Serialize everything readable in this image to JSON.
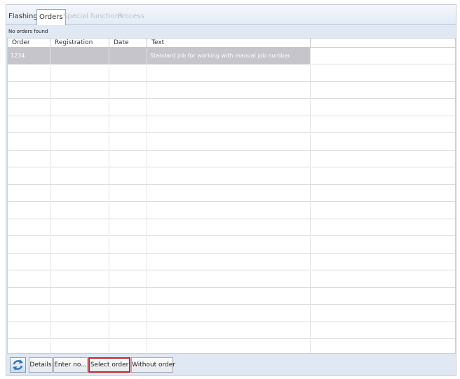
{
  "tabs": [
    {
      "label": "Flashing",
      "state": "normal"
    },
    {
      "label": "Orders",
      "state": "active"
    },
    {
      "label": "Special functions",
      "state": "disabled"
    },
    {
      "label": "Process",
      "state": "disabled"
    }
  ],
  "status_text": "No orders found",
  "table": {
    "columns": [
      "Order",
      "Registration",
      "Date",
      "Text"
    ],
    "rows": [
      {
        "order": "1234",
        "registration": "",
        "date": "",
        "text": "Standard job for working with manual job number."
      }
    ]
  },
  "toolbar": {
    "refresh_icon": "refresh-icon",
    "details_label": "Details",
    "enter_no_label": "Enter no...",
    "select_order_label": "Select order",
    "without_order_label": "Without order"
  },
  "colors": {
    "selection": "#c5c5cb",
    "highlight_border": "#c0272d",
    "tab_disabled": "#b9c4d1"
  }
}
